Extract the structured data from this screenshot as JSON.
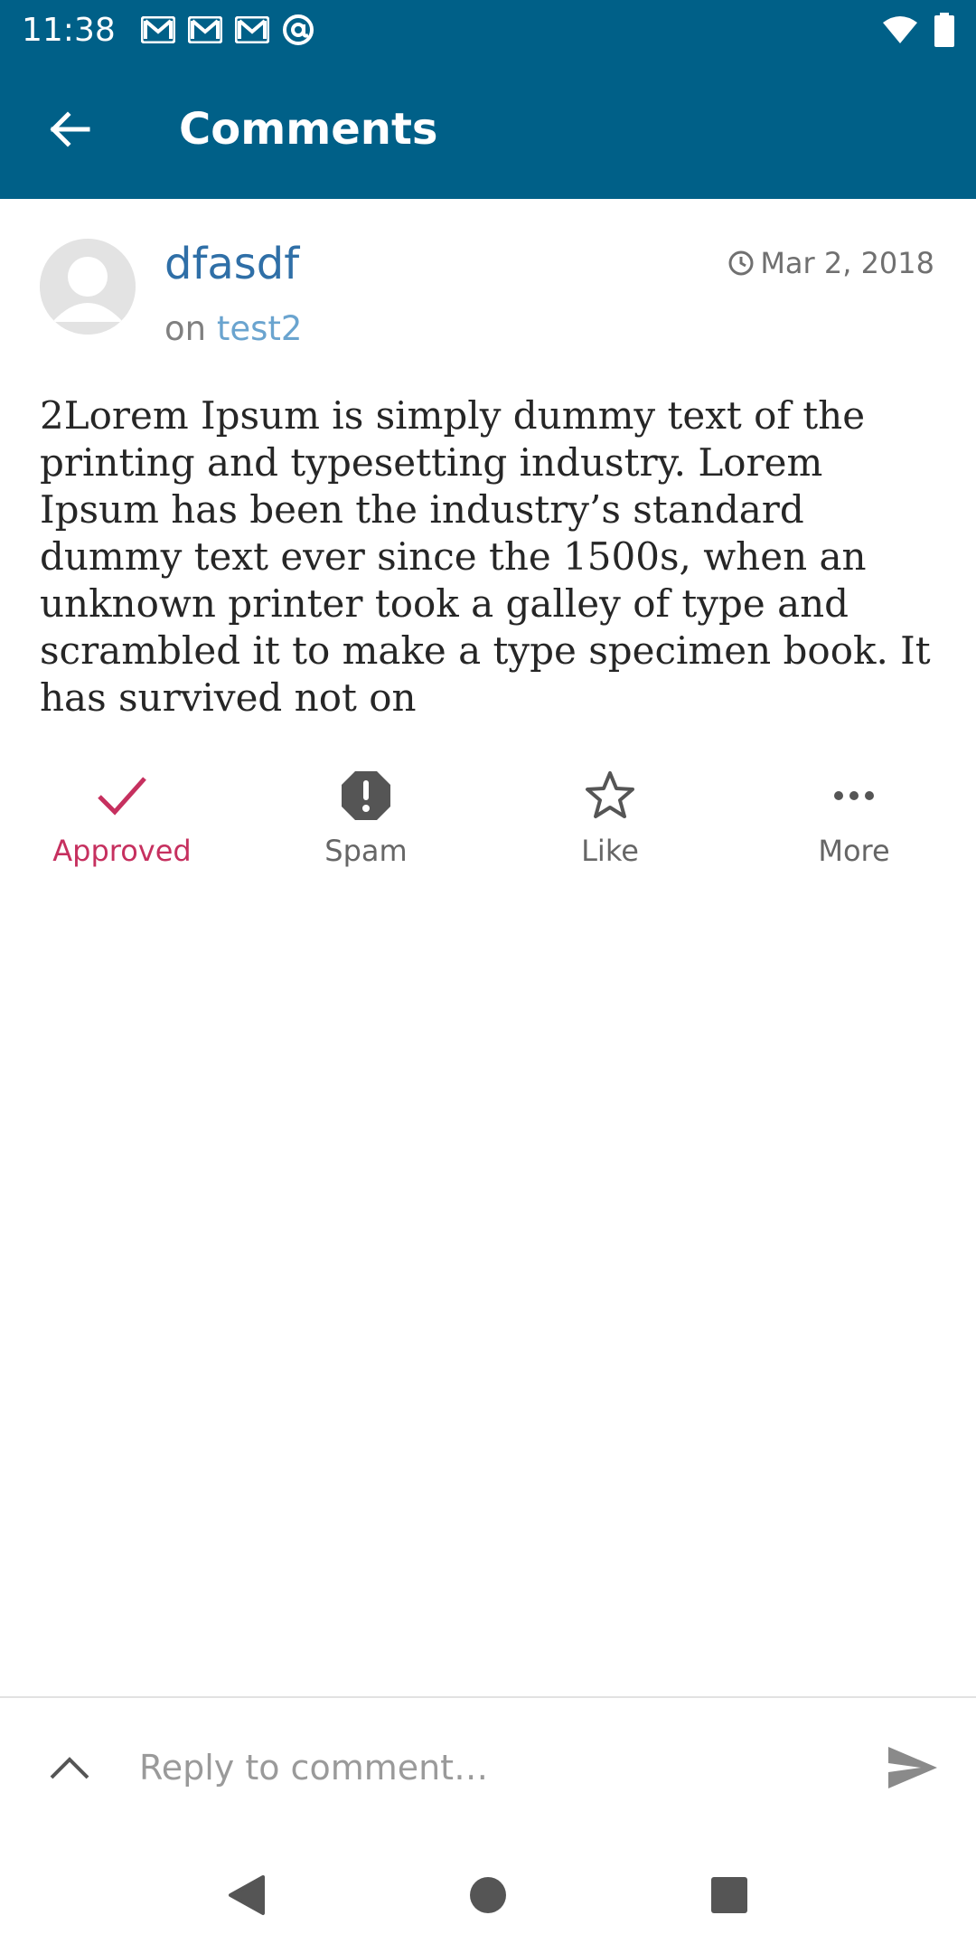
{
  "status_bar": {
    "time": "11:38",
    "notification_icons": [
      "gmail-icon",
      "gmail-icon",
      "gmail-icon",
      "at-sign-icon"
    ],
    "right_icons": [
      "wifi-icon",
      "battery-icon"
    ]
  },
  "app_bar": {
    "title": "Comments",
    "back_icon": "arrow-back-icon",
    "background_color": "#006088"
  },
  "comment": {
    "author": "dfasdf",
    "on_prefix": "on",
    "post_title": "test2",
    "date": "Mar 2, 2018",
    "date_icon": "clock-icon",
    "body": "2Lorem Ipsum is simply dummy text of the printing and typesetting industry. Lorem Ipsum has been the industry’s standard dummy text ever since the 1500s, when an unknown printer took a galley of type and scrambled it to make a type specimen book. It has survived not on"
  },
  "actions": [
    {
      "label": "Approved",
      "icon": "check-icon",
      "active": true
    },
    {
      "label": "Spam",
      "icon": "spam-icon",
      "active": false
    },
    {
      "label": "Like",
      "icon": "star-outline-icon",
      "active": false
    },
    {
      "label": "More",
      "icon": "more-horizontal-icon",
      "active": false
    }
  ],
  "reply": {
    "placeholder": "Reply to comment…",
    "expand_icon": "chevron-up-icon",
    "send_icon": "send-icon"
  },
  "nav_bar": {
    "buttons": [
      "back-triangle-icon",
      "home-circle-icon",
      "recents-square-icon"
    ]
  },
  "colors": {
    "accent": "#c6305f",
    "link": "#2f6fa7",
    "post_link": "#6aa4cf"
  }
}
